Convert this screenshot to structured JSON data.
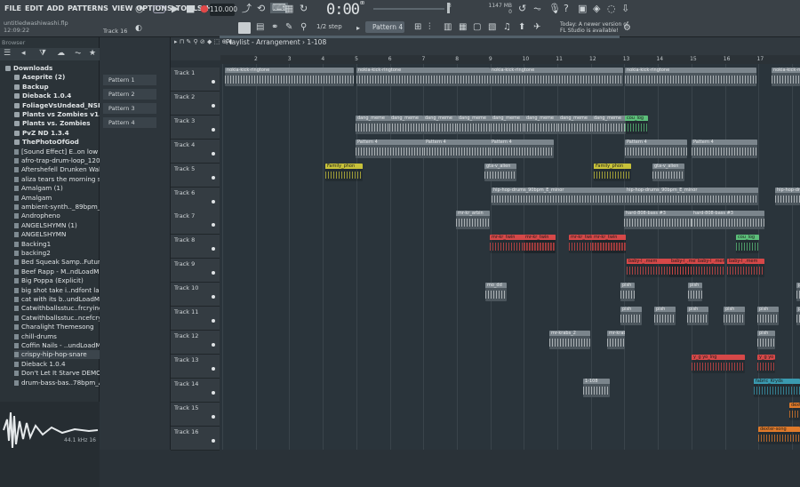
{
  "menu": [
    "FILE",
    "EDIT",
    "ADD",
    "PATTERNS",
    "VIEW",
    "OPTIONS",
    "TOOLS",
    "HELP"
  ],
  "file": {
    "name": "untitledwashiwashi.flp",
    "time": "12:09:22"
  },
  "toolbar": {
    "tempo": "110.000",
    "time_main": "0:00",
    "time_sub": "00",
    "mem_left": "3",
    "mem_right": "1147 MB",
    "mem_line2": "0",
    "step": "1/2 step",
    "pattern": "Pattern 4"
  },
  "news": "Today: A newer version of FL Studio is available!",
  "browser": {
    "title": "Browser",
    "items": [
      {
        "label": "Downloads",
        "type": "folder"
      },
      {
        "label": "Aseprite (2)",
        "type": "folder"
      },
      {
        "label": "Backup",
        "type": "folder"
      },
      {
        "label": "Dieback 1.0.4",
        "type": "folder"
      },
      {
        "label": "FoliageVsUndead_NSE",
        "type": "folder"
      },
      {
        "label": "Plants vs Zombies v1.0.0.1051",
        "type": "folder"
      },
      {
        "label": "Plants vs. Zombies",
        "type": "folder"
      },
      {
        "label": "PvZ ND 1.3.4",
        "type": "folder"
      },
      {
        "label": "ThePhotoOfGod",
        "type": "folder"
      },
      {
        "label": "[Sound Effect] E..on low health)",
        "type": "file"
      },
      {
        "label": "afro-trap-drum-loop_120bpm",
        "type": "file"
      },
      {
        "label": "Aftershefell Drunken Waltz",
        "type": "file"
      },
      {
        "label": "aliza tears the morning star",
        "type": "file"
      },
      {
        "label": "Amalgam (1)",
        "type": "file"
      },
      {
        "label": "Amalgam",
        "type": "file"
      },
      {
        "label": "ambient-synth.._89bpm_F_major",
        "type": "file"
      },
      {
        "label": "Andropheno",
        "type": "file"
      },
      {
        "label": "ANGELSHYMN (1)",
        "type": "file"
      },
      {
        "label": "ANGELSHYMN",
        "type": "file"
      },
      {
        "label": "Backing1",
        "type": "file"
      },
      {
        "label": "backing2",
        "type": "file"
      },
      {
        "label": "Bed Squeak Samp..Future Bass]",
        "type": "file"
      },
      {
        "label": "Beef Rapp - M..ndLoadMate.com",
        "type": "file"
      },
      {
        "label": "Big Poppa (Explicit)",
        "type": "file"
      },
      {
        "label": "big shot take i..ndfont last night",
        "type": "file"
      },
      {
        "label": "cat with its b..undLoadMate.com",
        "type": "file"
      },
      {
        "label": "Catwithballsstuc..frcryingbaby (1)",
        "type": "file"
      },
      {
        "label": "Catwithballsstuc..ncefcryingbaby",
        "type": "file"
      },
      {
        "label": "Charalight Themesong",
        "type": "file"
      },
      {
        "label": "chill-drums",
        "type": "file"
      },
      {
        "label": "Coffin Nails - ..undLoadMate.com",
        "type": "file"
      },
      {
        "label": "crispy-hip-hop-snare",
        "type": "file",
        "selected": true
      },
      {
        "label": "Dieback 1.0.4",
        "type": "file"
      },
      {
        "label": "Don't Let It Starve DEMO",
        "type": "file"
      },
      {
        "label": "drum-bass-bas..78bpm_A_minor",
        "type": "file"
      }
    ],
    "preview_info": "44.1 kHz 16"
  },
  "channel": {
    "track_label": "Track 16",
    "patterns": [
      "Pattern 1",
      "Pattern 2",
      "Pattern 3",
      "Pattern 4"
    ]
  },
  "playlist": {
    "title": "Playlist - Arrangement",
    "breadcrumb": "1-108",
    "ruler": [
      "2",
      "3",
      "4",
      "5",
      "6",
      "7",
      "8",
      "9",
      "10",
      "11",
      "12",
      "13",
      "14",
      "15",
      "16",
      "17"
    ],
    "tracks": [
      "Track 1",
      "Track 2",
      "Track 3",
      "Track 4",
      "Track 5",
      "Track 6",
      "Track 7",
      "Track 8",
      "Track 9",
      "Track 10",
      "Track 11",
      "Track 12",
      "Track 13",
      "Track 14",
      "Track 15",
      "Track 16"
    ]
  },
  "clips": [
    {
      "label": "nokia-kick-ringtone",
      "color": "#7b858c"
    },
    {
      "label": "dang_meme",
      "color": "#7b858c"
    },
    {
      "label": "Pattern 4",
      "color": "#7b858c"
    },
    {
      "label": "Family_phon",
      "color": "#c8c23a"
    },
    {
      "label": "gta-v_alien",
      "color": "#7b858c"
    },
    {
      "label": "hip-hop-drums_90bpm_E_minor",
      "color": "#7b858c"
    },
    {
      "label": "mr-kr_arbin",
      "color": "#7b858c"
    },
    {
      "label": "hard-808-bass #3",
      "color": "#7b858c"
    },
    {
      "label": "mr-kr_twin",
      "color": "#d64848"
    },
    {
      "label": "baby-l_.mem",
      "color": "#d64848"
    },
    {
      "label": "mo_dd",
      "color": "#7b858c"
    },
    {
      "label": "pish",
      "color": "#7b858c"
    },
    {
      "label": "mr-krabs_2",
      "color": "#7b858c"
    },
    {
      "label": "y_g yo_lng",
      "color": "#d64848"
    },
    {
      "label": "1-108",
      "color": "#7b858c"
    },
    {
      "label": "fabric_Kryds",
      "color": "#3a9ab0"
    },
    {
      "label": "dexter-song",
      "color": "#e07a2a"
    },
    {
      "label": "cou_log",
      "color": "#5cbf7a"
    }
  ]
}
